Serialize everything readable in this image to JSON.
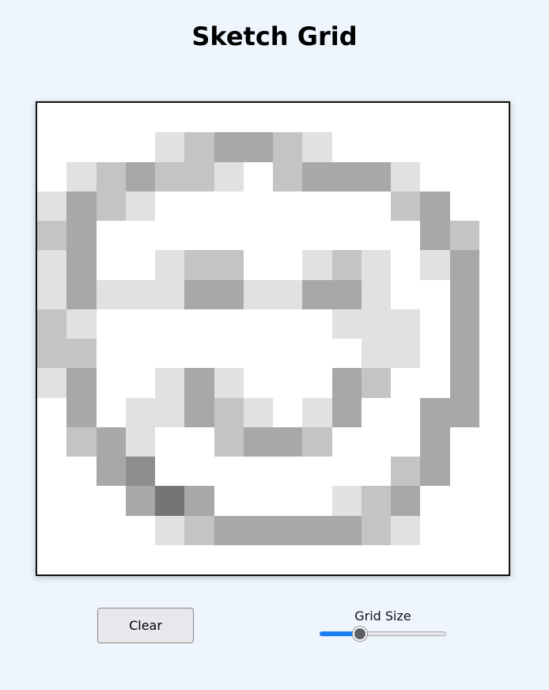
{
  "page": {
    "title": "Sketch Grid",
    "background_color": "#eef5fd"
  },
  "controls": {
    "clear_label": "Clear",
    "grid_size_label": "Grid Size",
    "grid_size_level": 0.32,
    "slider_accent_color": "#1a7ff5"
  },
  "grid": {
    "columns": 16,
    "rows": 16,
    "shade_colors": {
      "0": "#ffffff",
      "1": "#e1e1e1",
      "2": "#c4c4c4",
      "3": "#a8a8a8",
      "4": "#8e8e8e",
      "5": "#757575"
    },
    "cells": [
      [
        0,
        0,
        0,
        0,
        0,
        0,
        0,
        0,
        0,
        0,
        0,
        0,
        0,
        0,
        0,
        0
      ],
      [
        0,
        0,
        0,
        0,
        1,
        2,
        3,
        3,
        2,
        1,
        0,
        0,
        0,
        0,
        0,
        0
      ],
      [
        0,
        1,
        2,
        3,
        2,
        2,
        1,
        0,
        2,
        3,
        3,
        3,
        1,
        0,
        0,
        0
      ],
      [
        1,
        3,
        2,
        1,
        0,
        0,
        0,
        0,
        0,
        0,
        0,
        0,
        2,
        3,
        0,
        0
      ],
      [
        2,
        3,
        0,
        0,
        0,
        0,
        0,
        0,
        0,
        0,
        0,
        0,
        0,
        3,
        2,
        0
      ],
      [
        1,
        3,
        0,
        0,
        1,
        2,
        2,
        0,
        0,
        1,
        2,
        1,
        0,
        1,
        3,
        0
      ],
      [
        1,
        3,
        1,
        1,
        1,
        3,
        3,
        1,
        1,
        3,
        3,
        1,
        0,
        0,
        3,
        0
      ],
      [
        2,
        1,
        0,
        0,
        0,
        0,
        0,
        0,
        0,
        0,
        1,
        1,
        1,
        0,
        3,
        0
      ],
      [
        2,
        2,
        0,
        0,
        0,
        0,
        0,
        0,
        0,
        0,
        0,
        1,
        1,
        0,
        3,
        0
      ],
      [
        1,
        3,
        0,
        0,
        1,
        3,
        1,
        0,
        0,
        0,
        3,
        2,
        0,
        0,
        3,
        0
      ],
      [
        0,
        3,
        0,
        1,
        1,
        3,
        2,
        1,
        0,
        1,
        3,
        0,
        0,
        3,
        3,
        0
      ],
      [
        0,
        2,
        3,
        1,
        0,
        0,
        2,
        3,
        3,
        2,
        0,
        0,
        0,
        3,
        0,
        0
      ],
      [
        0,
        0,
        3,
        4,
        0,
        0,
        0,
        0,
        0,
        0,
        0,
        0,
        2,
        3,
        0,
        0
      ],
      [
        0,
        0,
        0,
        3,
        5,
        3,
        0,
        0,
        0,
        0,
        1,
        2,
        3,
        0,
        0,
        0
      ],
      [
        0,
        0,
        0,
        0,
        1,
        2,
        3,
        3,
        3,
        3,
        3,
        2,
        1,
        0,
        0,
        0
      ],
      [
        0,
        0,
        0,
        0,
        0,
        0,
        0,
        0,
        0,
        0,
        0,
        0,
        0,
        0,
        0,
        0
      ]
    ]
  }
}
